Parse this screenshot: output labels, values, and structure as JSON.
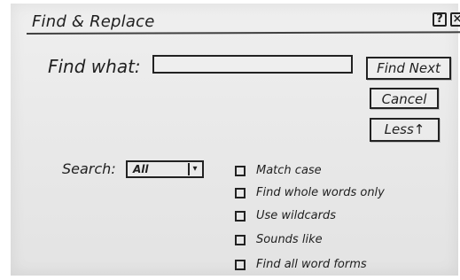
{
  "dialog": {
    "title": "Find & Replace",
    "help_icon": "question-icon",
    "close_icon": "close-icon"
  },
  "find": {
    "label": "Find what:",
    "value": "",
    "placeholder": ""
  },
  "buttons": {
    "find_next": "Find Next",
    "cancel": "Cancel",
    "less": "Less↑"
  },
  "search": {
    "label": "Search:",
    "selected": "All",
    "dropdown_icon": "chevron-down-icon"
  },
  "options": [
    {
      "label": "Match case",
      "checked": false
    },
    {
      "label": "Find whole words only",
      "checked": false
    },
    {
      "label": "Use wildcards",
      "checked": false
    },
    {
      "label": "Sounds like",
      "checked": false
    },
    {
      "label": "Find all word forms",
      "checked": false
    }
  ]
}
